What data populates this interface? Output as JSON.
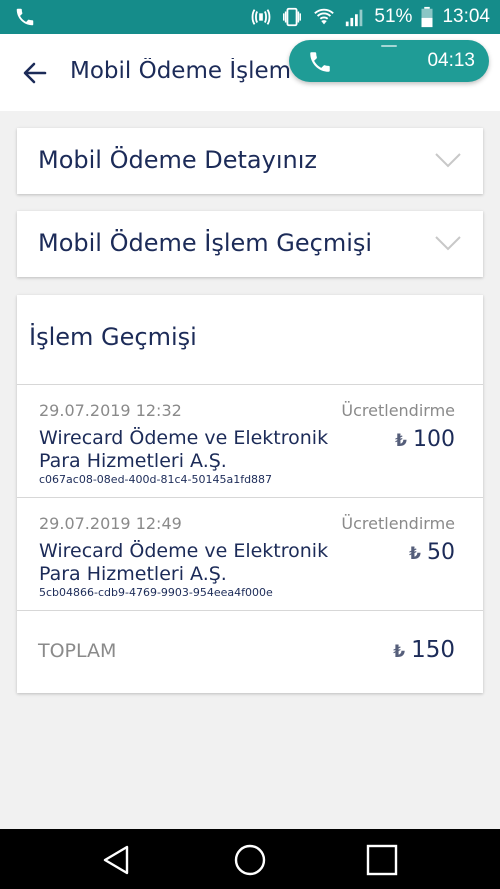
{
  "status_bar": {
    "battery_percent": "51%",
    "clock": "13:04",
    "icons": [
      "phone-icon",
      "vibrate-icon",
      "wifi-icon",
      "signal-icon",
      "battery-icon"
    ]
  },
  "app_bar": {
    "title": "Mobil Ödeme İşlem",
    "back_icon": "arrow-left-icon"
  },
  "call_pill": {
    "timer": "04:13",
    "icon": "phone-icon"
  },
  "accordions": [
    {
      "label": "Mobil Ödeme Detayınız",
      "icon": "chevron-down-icon"
    },
    {
      "label": "Mobil Ödeme İşlem Geçmişi",
      "icon": "chevron-down-icon"
    }
  ],
  "history": {
    "title": "İşlem Geçmişi",
    "currency_symbol": "₺",
    "transactions": [
      {
        "date": "29.07.2019 12:32",
        "type": "Ücretlendirme",
        "merchant_line1": "Wirecard Ödeme ve Elektronik",
        "merchant_line2": "Para Hizmetleri A.Ş.",
        "reference": "c067ac08-08ed-400d-81c4-50145a1fd887",
        "amount": "100"
      },
      {
        "date": "29.07.2019 12:49",
        "type": "Ücretlendirme",
        "merchant_line1": "Wirecard Ödeme ve Elektronik",
        "merchant_line2": "Para Hizmetleri A.Ş.",
        "reference": "5cb04866-cdb9-4769-9903-954eea4f000e",
        "amount": "50"
      }
    ],
    "total_label": "TOPLAM",
    "total_amount": "150"
  },
  "colors": {
    "status_bar": "#158c8a",
    "call_pill": "#1f9c96",
    "text_primary": "#1c2b58",
    "text_muted": "#8a8a8a",
    "background": "#f1f1f1"
  },
  "nav_bar": {
    "icons": [
      "back-triangle-icon",
      "home-circle-icon",
      "recents-square-icon"
    ]
  }
}
